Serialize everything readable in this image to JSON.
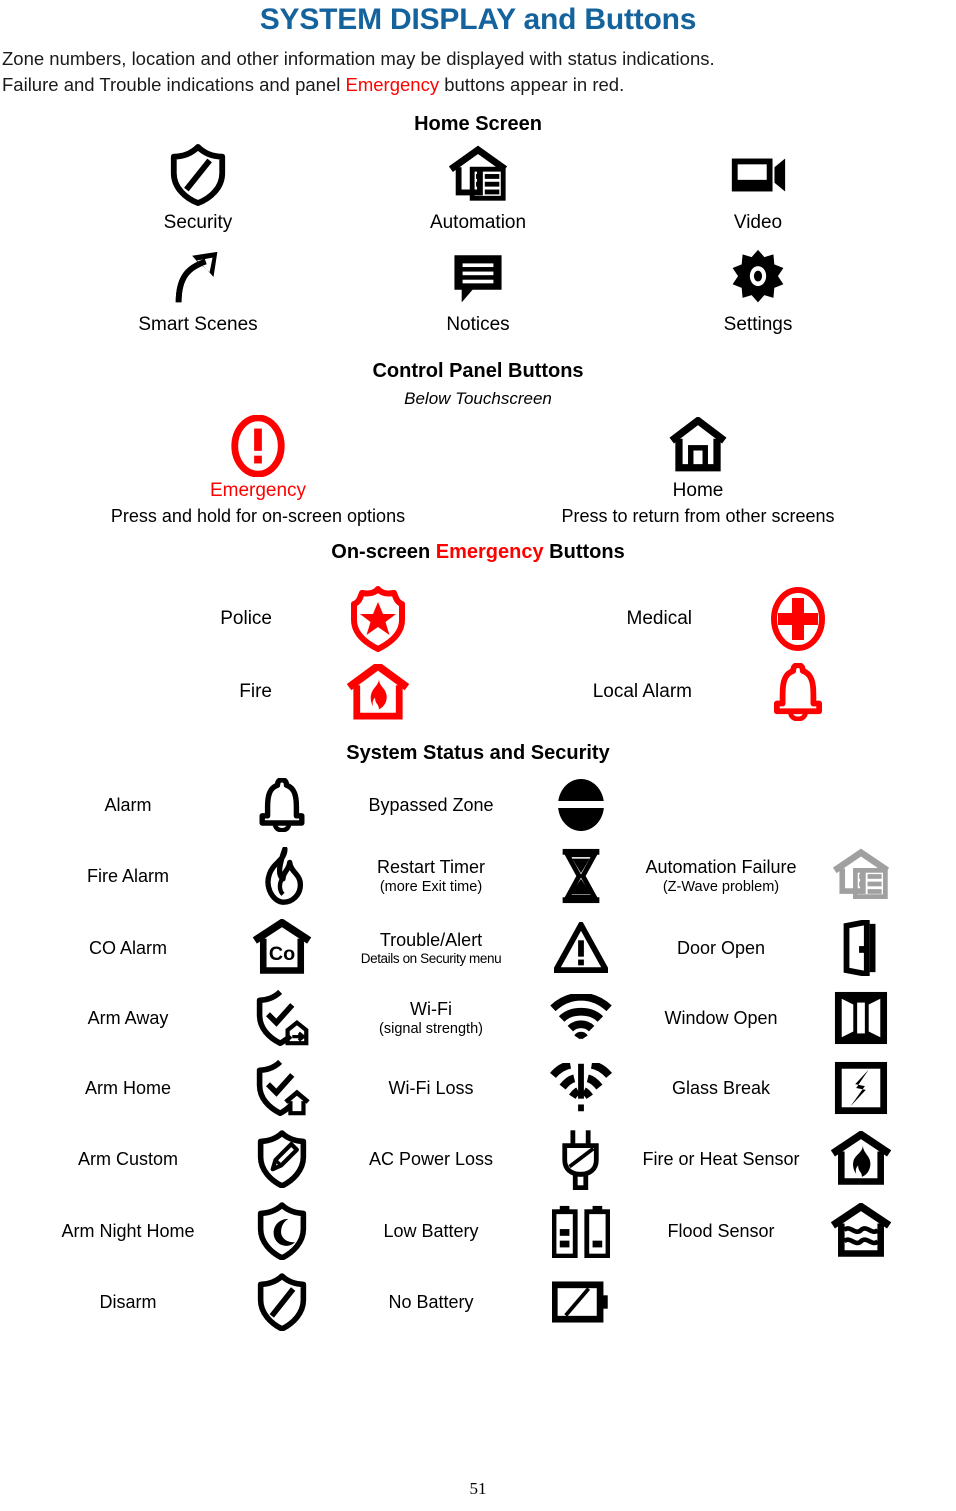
{
  "page": {
    "title": "SYSTEM DISPLAY and Buttons",
    "title_color": "#14639c",
    "accent_red": "#ff0000",
    "gray": "#a0a0a0",
    "page_number": "51",
    "intro": {
      "line1": "Zone numbers, location and other information may be displayed with status indications.",
      "line2_part1": "Failure and Trouble indications and panel ",
      "line2_emphasis": "Emergency",
      "line2_part2": " buttons appear in red."
    }
  },
  "home_screen": {
    "heading": "Home Screen",
    "items": [
      {
        "label": "Security",
        "icon": "shield-slash-icon"
      },
      {
        "label": "Automation",
        "icon": "house-list-icon"
      },
      {
        "label": "Video",
        "icon": "video-camera-icon"
      },
      {
        "label": "Smart Scenes",
        "icon": "curved-arrow-icon"
      },
      {
        "label": "Notices",
        "icon": "speech-bubble-lines-icon"
      },
      {
        "label": "Settings",
        "icon": "gear-icon"
      }
    ]
  },
  "control_panel": {
    "heading": "Control Panel Buttons",
    "subheading": "Below Touchscreen",
    "buttons": [
      {
        "label": "Emergency",
        "icon": "exclamation-oval-icon",
        "label_color": "#ff0000",
        "hint": "Press and hold for on-screen options"
      },
      {
        "label": "Home",
        "icon": "house-outline-icon",
        "label_color": "#000000",
        "hint": "Press to return from other screens"
      }
    ]
  },
  "onscreen_emergency": {
    "heading_part1": "On-screen ",
    "heading_emphasis": "Emergency",
    "heading_part2": " Buttons",
    "rows": [
      {
        "left": {
          "label": "Police",
          "icon": "police-badge-star-icon"
        },
        "right": {
          "label": "Medical",
          "icon": "medical-cross-oval-icon"
        }
      },
      {
        "left": {
          "label": "Fire",
          "icon": "house-flame-icon"
        },
        "right": {
          "label": "Local Alarm",
          "icon": "bell-icon"
        }
      }
    ]
  },
  "system_status": {
    "heading": "System Status and Security",
    "rows": [
      {
        "c1": {
          "label": "Alarm",
          "icon": "bell-icon"
        },
        "c2": {
          "label": "Bypassed Zone",
          "icon": "circle-bar-icon"
        },
        "c3": null
      },
      {
        "c1": {
          "label": "Fire Alarm",
          "icon": "flame-icon"
        },
        "c2": {
          "label": "Restart Timer",
          "sub": "(more Exit time)",
          "icon": "hourglass-icon"
        },
        "c3": {
          "label": "Automation Failure",
          "sub": "(Z-Wave problem)",
          "icon": "house-list-gray-icon"
        }
      },
      {
        "c1": {
          "label": "CO Alarm",
          "icon": "house-co-icon"
        },
        "c2": {
          "label": "Trouble/Alert",
          "sub": "Details on Security menu",
          "sub_tight": true,
          "icon": "warning-triangle-icon"
        },
        "c3": {
          "label": "Door Open",
          "icon": "door-open-icon"
        }
      },
      {
        "c1": {
          "label": "Arm Away",
          "icon": "shield-check-away-icon"
        },
        "c2": {
          "label": "Wi-Fi",
          "sub": "(signal strength)",
          "icon": "wifi-icon"
        },
        "c3": {
          "label": "Window Open",
          "icon": "window-open-icon"
        }
      },
      {
        "c1": {
          "label": "Arm Home",
          "icon": "shield-check-home-icon"
        },
        "c2": {
          "label": "Wi-Fi Loss",
          "icon": "wifi-loss-icon"
        },
        "c3": {
          "label": "Glass Break",
          "icon": "glass-break-icon"
        }
      },
      {
        "c1": {
          "label": "Arm Custom",
          "icon": "shield-pencil-icon"
        },
        "c2": {
          "label": "AC Power Loss",
          "icon": "power-plug-icon"
        },
        "c3": {
          "label": "Fire or Heat Sensor",
          "icon": "house-flame-sensor-icon"
        }
      },
      {
        "c1": {
          "label": "Arm Night Home",
          "icon": "shield-moon-icon"
        },
        "c2": {
          "label": "Low Battery",
          "icon": "low-battery-icon"
        },
        "c3": {
          "label": "Flood Sensor",
          "icon": "house-water-icon"
        }
      },
      {
        "c1": {
          "label": "Disarm",
          "icon": "shield-slash-icon"
        },
        "c2": {
          "label": "No Battery",
          "icon": "no-battery-icon"
        },
        "c3": null
      }
    ]
  }
}
